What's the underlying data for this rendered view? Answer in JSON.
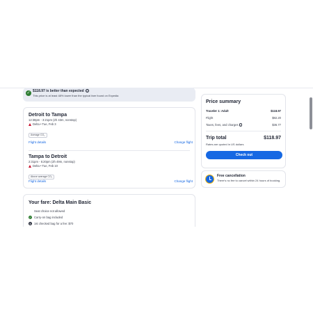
{
  "banner": {
    "title": "$118.97 is better than expected",
    "subtitle": "This price is at least 48% lower than the typical fare found on Expedia",
    "check_icon": "check-circle-icon",
    "info_icon": "info-icon"
  },
  "flights": [
    {
      "route": "Detroit to Tampa",
      "time": "12:38pm - 3:21pm (2h 43m, nonstop)",
      "airline": "Delta • Tue, Feb 3",
      "badge": "Average CO₂",
      "details_link": "Flight details",
      "change_link": "Change flight"
    },
    {
      "route": "Tampa to Detroit",
      "time": "2:31pm - 5:20pm (2h 49m, nonstop)",
      "airline": "Delta • Tue, Feb 10",
      "badge": "Above average CO₂",
      "details_link": "Flight details",
      "change_link": "Change flight"
    }
  ],
  "fare": {
    "heading": "Your fare: Delta Main Basic",
    "items": [
      {
        "icon": "close-icon",
        "text": "Seat choice not allowed"
      },
      {
        "icon": "check-icon",
        "text": "Carry-on bag included"
      },
      {
        "icon": "dollar-icon",
        "text": "1st checked bag for a fee: $70"
      }
    ]
  },
  "summary": {
    "heading": "Price summary",
    "traveler_label": "Traveler 1: Adult",
    "traveler_amount": "$118.97",
    "flight_label": "Flight",
    "flight_amount": "$82.20",
    "taxes_label": "Taxes, fees, and charges",
    "taxes_amount": "$36.77",
    "total_label": "Trip total",
    "total_amount": "$118.97",
    "note": "Rates are quoted in US dollars",
    "checkout_label": "Check out"
  },
  "cancellation": {
    "title": "Free cancellation",
    "subtitle": "There's no fee to cancel within 24 hours of booking."
  },
  "colors": {
    "accent": "#1668e3",
    "success": "#2e7d32",
    "delta_red": "#c8102e"
  }
}
